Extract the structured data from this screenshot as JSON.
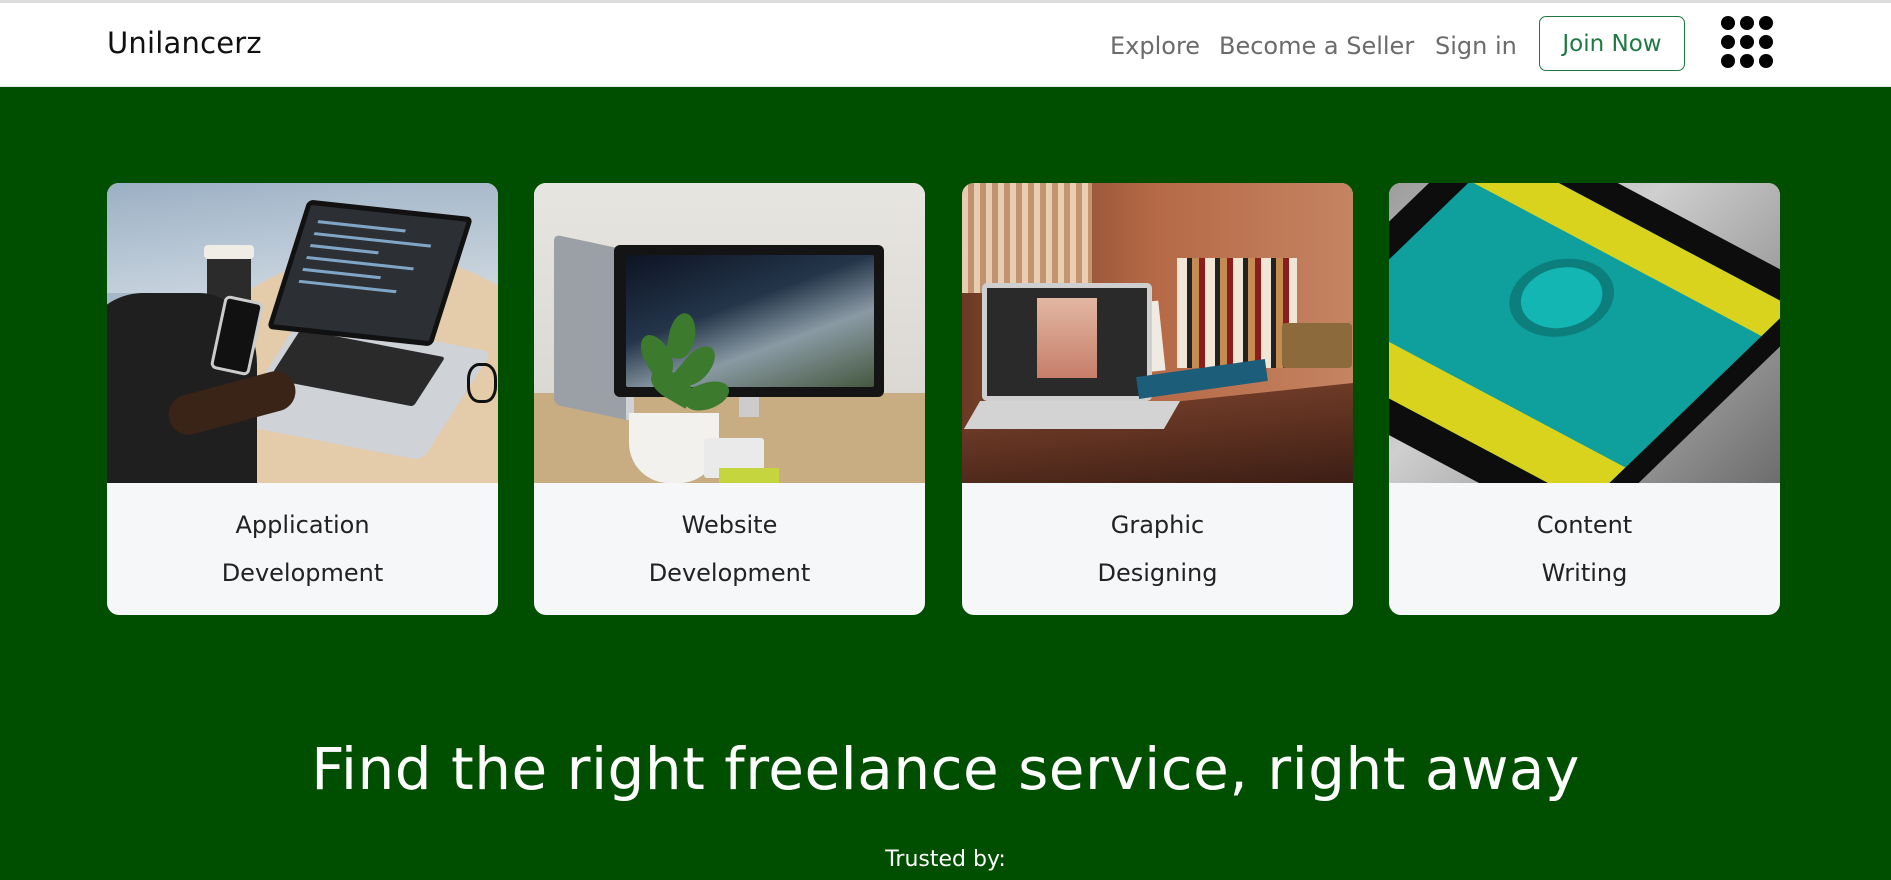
{
  "navbar": {
    "brand": "Unilancerz",
    "links": [
      "Explore",
      "Become a Seller",
      "Sign in"
    ],
    "join_button": "Join Now",
    "menu_icon": "grid-icon"
  },
  "cards": [
    {
      "line1": "Application",
      "line2": "Development",
      "image": "laptop-and-phone-image"
    },
    {
      "line1": "Website",
      "line2": "Development",
      "image": "desk-monitor-image"
    },
    {
      "line1": "Graphic",
      "line2": "Designing",
      "image": "design-desk-image"
    },
    {
      "line1": "Content",
      "line2": "Writing",
      "image": "smartphone-image"
    }
  ],
  "hero": {
    "headline": "Find the right freelance service, right away",
    "trusted_by": "Trusted by:"
  },
  "colors": {
    "hero_bg": "#004e00",
    "accent": "#1e7a43",
    "card_bg": "#f6f7f9"
  }
}
